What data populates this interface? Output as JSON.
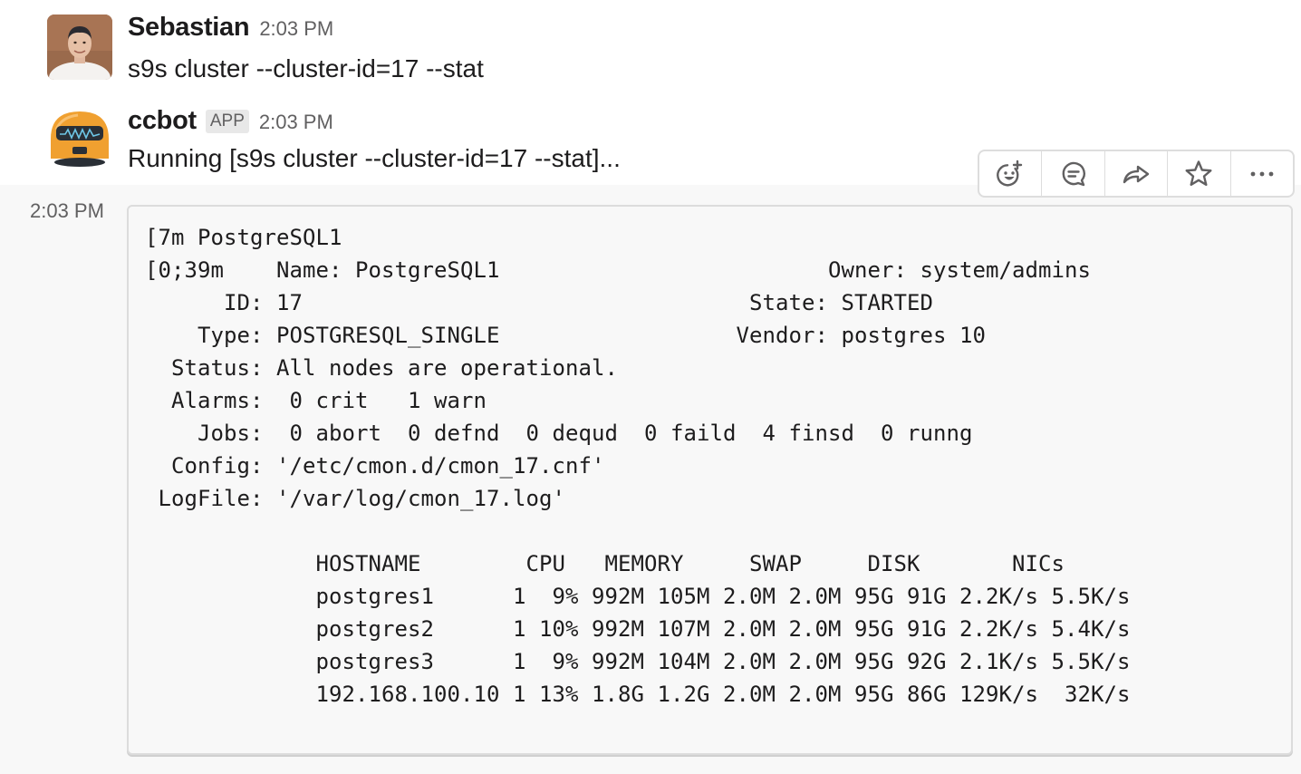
{
  "messages": [
    {
      "sender": "Sebastian",
      "timestamp": "2:03 PM",
      "text": "s9s cluster --cluster-id=17 --stat",
      "avatar": "user-photo-avatar"
    },
    {
      "sender": "ccbot",
      "badge": "APP",
      "timestamp": "2:03 PM",
      "text": "Running [s9s cluster --cluster-id=17 --stat]...",
      "avatar": "robot-avatar"
    }
  ],
  "continuation": {
    "timestamp": "2:03 PM",
    "code_lines": [
      "[7m PostgreSQL1",
      "[0;39m    Name: PostgreSQL1                         Owner: system/admins",
      "      ID: 17                                  State: STARTED",
      "    Type: POSTGRESQL_SINGLE                  Vendor: postgres 10",
      "  Status: All nodes are operational.",
      "  Alarms:  0 crit   1 warn",
      "    Jobs:  0 abort  0 defnd  0 dequd  0 faild  4 finsd  0 runng",
      "  Config: '/etc/cmon.d/cmon_17.cnf'",
      " LogFile: '/var/log/cmon_17.log'",
      "",
      "             HOSTNAME        CPU   MEMORY     SWAP     DISK       NICs",
      "             postgres1      1  9% 992M 105M 2.0M 2.0M 95G 91G 2.2K/s 5.5K/s",
      "             postgres2      1 10% 992M 107M 2.0M 2.0M 95G 91G 2.2K/s 5.4K/s",
      "             postgres3      1  9% 992M 104M 2.0M 2.0M 95G 92G 2.1K/s 5.5K/s",
      "             192.168.100.10 1 13% 1.8G 1.2G 2.0M 2.0M 95G 86G 129K/s  32K/s"
    ]
  },
  "toolbar": {
    "actions": [
      {
        "name": "add-reaction",
        "icon": "emoji-plus-icon"
      },
      {
        "name": "reply-in-thread",
        "icon": "speech-bubble-icon"
      },
      {
        "name": "share-message",
        "icon": "share-arrow-icon"
      },
      {
        "name": "save-item",
        "icon": "star-icon"
      },
      {
        "name": "more-actions",
        "icon": "ellipsis-icon"
      }
    ]
  },
  "colors": {
    "text": "#1d1c1d",
    "muted": "#616061",
    "hover_bg": "#f8f8f8",
    "bot_orange": "#f0a030"
  }
}
